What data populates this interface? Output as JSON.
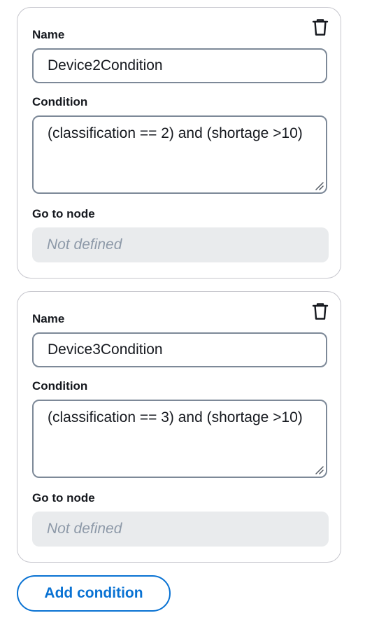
{
  "conditions": [
    {
      "name_label": "Name",
      "name_value": "Device2Condition",
      "condition_label": "Condition",
      "condition_value": "(classification == 2) and (shortage >10)",
      "goto_label": "Go to node",
      "goto_placeholder": "Not defined",
      "delete_icon": "trash-icon"
    },
    {
      "name_label": "Name",
      "name_value": "Device3Condition",
      "condition_label": "Condition",
      "condition_value": "(classification == 3) and (shortage >10)",
      "goto_label": "Go to node",
      "goto_placeholder": "Not defined",
      "delete_icon": "trash-icon"
    }
  ],
  "add_condition_label": "Add condition",
  "colors": {
    "accent": "#0972d3",
    "text": "#16191f",
    "border": "#7d8998",
    "card_border": "#c6c6cd",
    "disabled_bg": "#e9ebed",
    "placeholder": "#8d99a8"
  }
}
